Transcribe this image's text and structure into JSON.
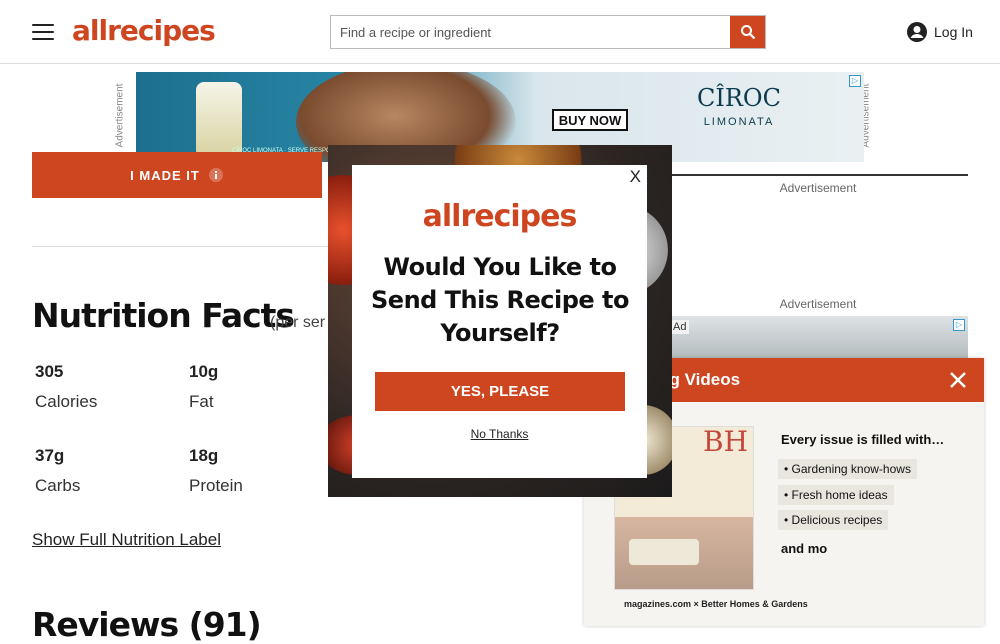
{
  "header": {
    "logo": "allrecipes",
    "search_placeholder": "Find a recipe or ingredient",
    "login_label": "Log In"
  },
  "ads": {
    "side_label": "Advertisement",
    "top_buy_now": "BUY NOW",
    "top_brand": "CÎROC",
    "top_flavor": "LIMONATA",
    "top_fineprint": "CÎROC LIMONATA · SERVE RESPONSIBLY",
    "right_label_1": "Advertisement",
    "right_label_2": "Advertisement",
    "right_ad_tag": "Ad"
  },
  "recipe": {
    "i_made_it": "I MADE IT"
  },
  "nutrition": {
    "title": "Nutrition Facts",
    "subtitle": "(per ser",
    "items": [
      {
        "value": "305",
        "label": "Calories"
      },
      {
        "value": "10g",
        "label": "Fat"
      },
      {
        "value": "37g",
        "label": "Carbs"
      },
      {
        "value": "18g",
        "label": "Protein"
      }
    ],
    "show_full": "Show Full Nutrition Label"
  },
  "reviews": {
    "title": "Reviews (91)"
  },
  "trending": {
    "title": "ding Videos",
    "headline": "Every issue is filled with…",
    "bullets": [
      "Gardening know-hows",
      "Fresh home ideas",
      "Delicious recipes"
    ],
    "more": "and mo",
    "footer": "magazines.com × Better Homes & Gardens",
    "mag_logo": "BH"
  },
  "modal": {
    "close": "X",
    "logo": "allrecipes",
    "heading": "Would You Like to Send This Recipe to Yourself?",
    "yes": "YES, PLEASE",
    "no": "No Thanks"
  },
  "colors": {
    "brand": "#ce4620"
  }
}
